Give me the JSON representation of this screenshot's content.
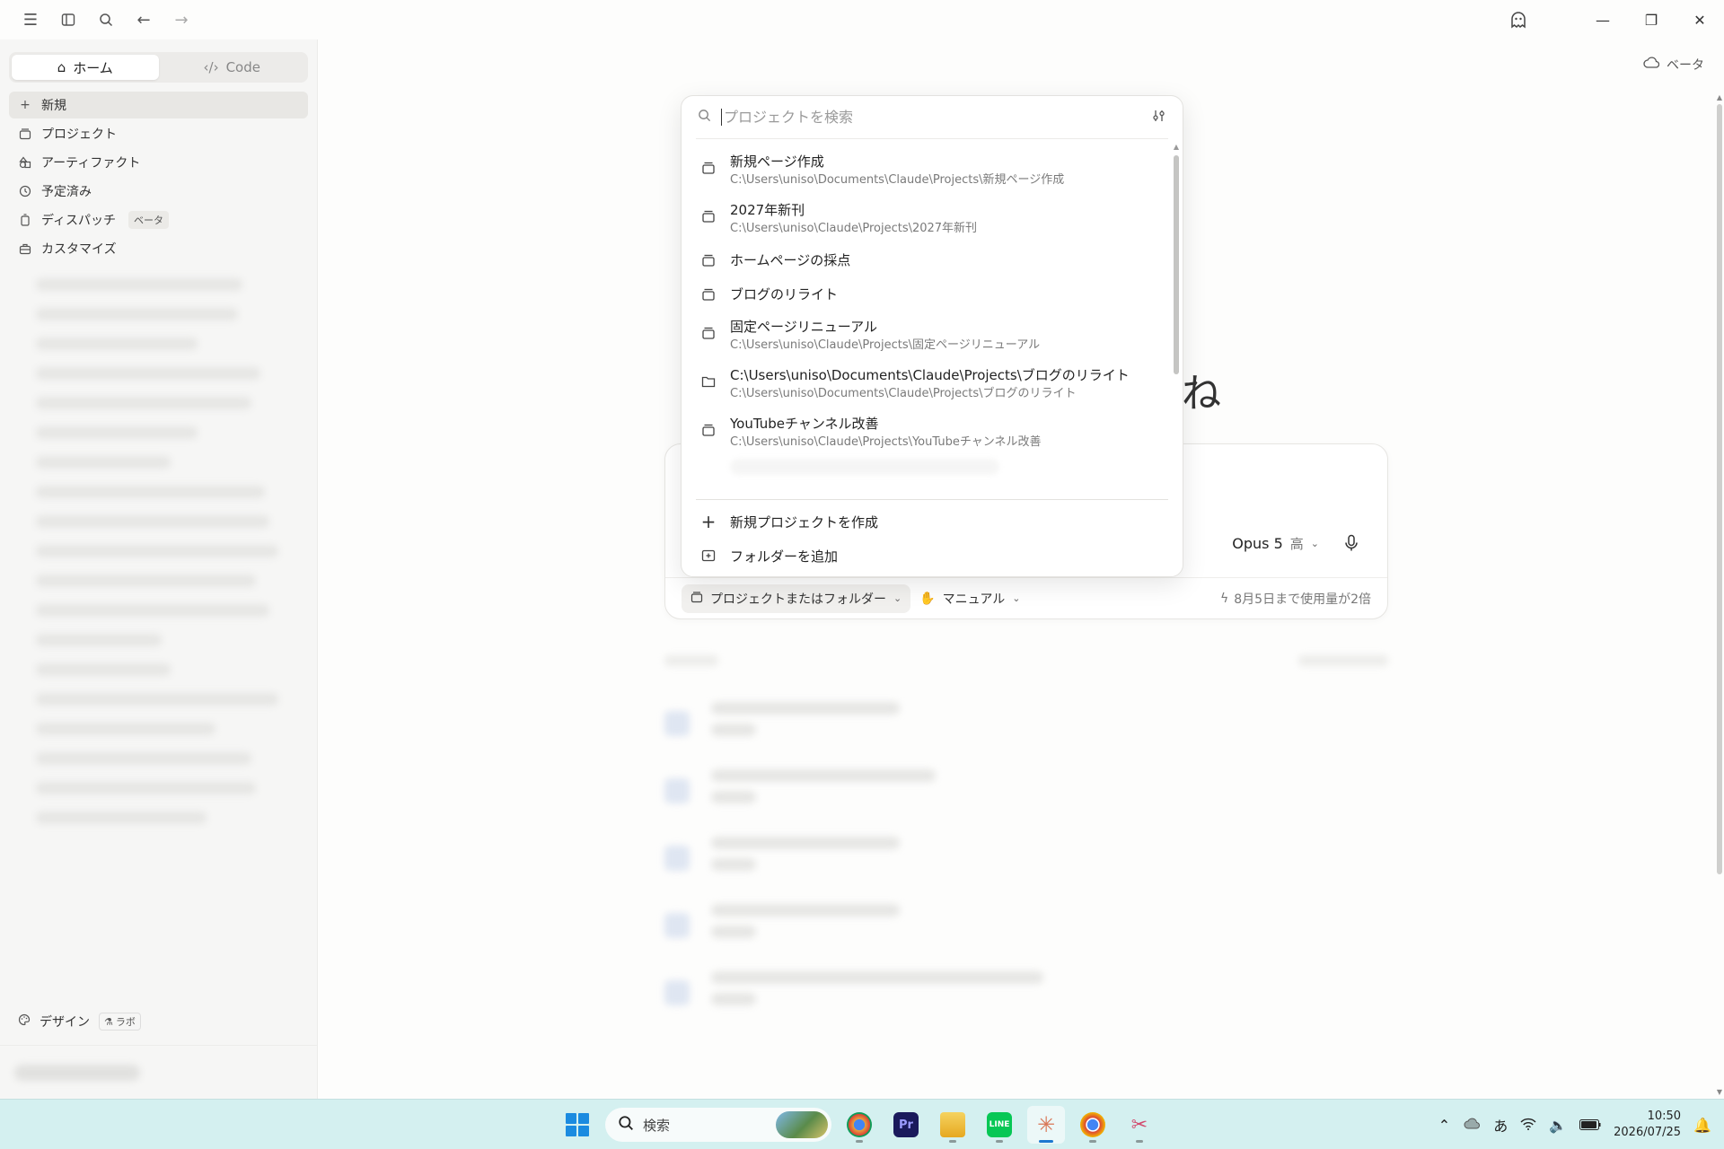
{
  "window": {
    "beta_label": "ベータ"
  },
  "sidebar": {
    "tabs": [
      {
        "label": "ホーム",
        "icon": "home-icon"
      },
      {
        "label": "Code",
        "icon": "code-icon"
      }
    ],
    "nav": [
      {
        "label": "新規",
        "icon": "plus-icon"
      },
      {
        "label": "プロジェクト",
        "icon": "folder-stack-icon"
      },
      {
        "label": "アーティファクト",
        "icon": "artifact-icon"
      },
      {
        "label": "予定済み",
        "icon": "clock-icon"
      },
      {
        "label": "ディスパッチ",
        "icon": "dispatch-icon",
        "badge": "ベータ"
      },
      {
        "label": "カスタマイズ",
        "icon": "toolbox-icon"
      }
    ],
    "design": {
      "label": "デザイン",
      "badge": "ラボ"
    }
  },
  "main": {
    "greeting_fragment": "ね",
    "composer": {
      "model": "Opus 5",
      "effort": "高",
      "project_chip": "プロジェクトまたはフォルダー",
      "mode_chip": "マニュアル",
      "usage": "8月5日まで使用量が2倍"
    }
  },
  "popup": {
    "search_placeholder": "プロジェクトを検索",
    "items": [
      {
        "name": "新規ページ作成",
        "path": "C:\\Users\\uniso\\Documents\\Claude\\Projects\\新規ページ作成",
        "icon": "project-icon"
      },
      {
        "name": "2027年新刊",
        "path": "C:\\Users\\uniso\\Claude\\Projects\\2027年新刊",
        "icon": "project-icon"
      },
      {
        "name": "ホームページの採点",
        "path": "",
        "icon": "project-icon"
      },
      {
        "name": "ブログのリライト",
        "path": "",
        "icon": "project-icon"
      },
      {
        "name": "固定ページリニューアル",
        "path": "C:\\Users\\uniso\\Claude\\Projects\\固定ページリニューアル",
        "icon": "project-icon"
      },
      {
        "name": "C:\\Users\\uniso\\Documents\\Claude\\Projects\\ブログのリライト",
        "path": "C:\\Users\\uniso\\Documents\\Claude\\Projects\\ブログのリライト",
        "icon": "folder-icon"
      },
      {
        "name": "YouTubeチャンネル改善",
        "path": "C:\\Users\\uniso\\Claude\\Projects\\YouTubeチャンネル改善",
        "icon": "project-icon"
      }
    ],
    "actions": {
      "new_project": "新規プロジェクトを作成",
      "add_folder": "フォルダーを追加"
    }
  },
  "taskbar": {
    "search_placeholder": "検索",
    "apps": [
      {
        "name": "chrome-profile",
        "color": "#e8a33d",
        "label": ""
      },
      {
        "name": "premiere",
        "color": "#1a1a5c",
        "label": "Pr"
      },
      {
        "name": "file-explorer",
        "color": "#f2c230",
        "label": ""
      },
      {
        "name": "line",
        "color": "#06c755",
        "label": "LINE"
      },
      {
        "name": "claude",
        "color": "#d97757",
        "label": "✳"
      },
      {
        "name": "chrome",
        "color": "#4285f4",
        "label": ""
      },
      {
        "name": "snipping-tool",
        "color": "#d24b6e",
        "label": "✂"
      }
    ],
    "ime": "あ",
    "time": "10:50",
    "date": "2026/07/25"
  }
}
